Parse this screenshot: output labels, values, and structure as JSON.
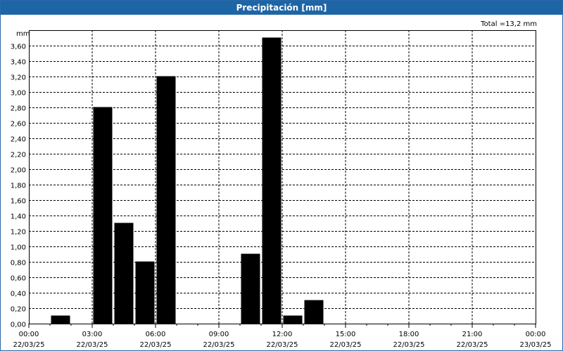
{
  "window": {
    "title": "Precipitación [mm]"
  },
  "chart_data": {
    "type": "bar",
    "title": "Precipitación [mm]",
    "ylabel": "mm",
    "total_label": "Total =13,2 mm",
    "ylim": [
      0,
      3.8
    ],
    "y_ticks": [
      "0,00",
      "0,20",
      "0,40",
      "0,60",
      "0,80",
      "1,00",
      "1,20",
      "1,40",
      "1,60",
      "1,80",
      "2,00",
      "2,20",
      "2,40",
      "2,60",
      "2,80",
      "3,00",
      "3,20",
      "3,40",
      "3,60"
    ],
    "x_ticks": [
      {
        "time": "00:00",
        "date": "22/03/25"
      },
      {
        "time": "03:00",
        "date": "22/03/25"
      },
      {
        "time": "06:00",
        "date": "22/03/25"
      },
      {
        "time": "09:00",
        "date": "22/03/25"
      },
      {
        "time": "12:00",
        "date": "22/03/25"
      },
      {
        "time": "15:00",
        "date": "22/03/25"
      },
      {
        "time": "18:00",
        "date": "22/03/25"
      },
      {
        "time": "21:00",
        "date": "22/03/25"
      },
      {
        "time": "00:00",
        "date": "23/03/25"
      }
    ],
    "x_unit": "hour of 22/03/25",
    "xlim": [
      0,
      24
    ],
    "bars": [
      {
        "hour": 2,
        "value": 0.1
      },
      {
        "hour": 3,
        "value": 0
      },
      {
        "hour": 4,
        "value": 2.8
      },
      {
        "hour": 5,
        "value": 1.3
      },
      {
        "hour": 6,
        "value": 0.8
      },
      {
        "hour": 7,
        "value": 3.2
      },
      {
        "hour": 11,
        "value": 0.9
      },
      {
        "hour": 12,
        "value": 3.7
      },
      {
        "hour": 13,
        "value": 0.1
      },
      {
        "hour": 14,
        "value": 0.3
      }
    ],
    "bar_color": "#000000",
    "grid": true
  }
}
